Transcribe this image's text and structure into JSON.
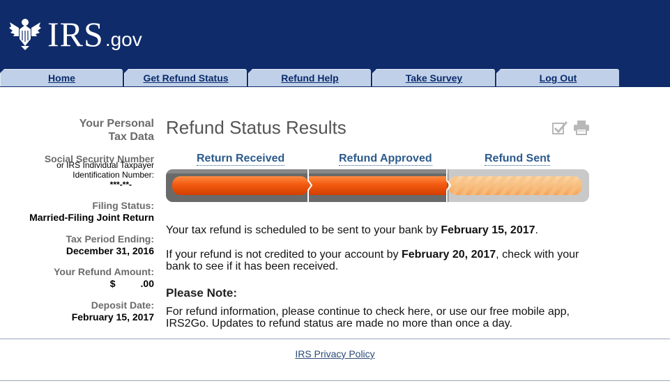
{
  "header": {
    "logo_text": "IRS",
    "logo_suffix": ".gov"
  },
  "nav": {
    "tabs": [
      {
        "label": "Home"
      },
      {
        "label": "Get Refund Status"
      },
      {
        "label": "Refund Help"
      },
      {
        "label": "Take Survey"
      },
      {
        "label": "Log Out"
      }
    ]
  },
  "sidebar": {
    "heading_line1": "Your Personal",
    "heading_line2": "Tax Data",
    "ssn_label": "Social Security Number",
    "ssn_sub1": "or IRS Individual Taxpayer",
    "ssn_sub2": "Identification Number:",
    "ssn_value": "***-**-",
    "filing_label": "Filing Status:",
    "filing_value": "Married-Filing Joint Return",
    "period_label": "Tax Period Ending:",
    "period_value": "December 31, 2016",
    "amount_label": "Your Refund Amount:",
    "amount_currency": "$",
    "amount_value": ".00",
    "deposit_label": "Deposit Date:",
    "deposit_value": "February 15, 2017"
  },
  "main": {
    "title": "Refund Status Results",
    "steps": [
      "Return Received",
      "Refund Approved",
      "Refund Sent"
    ],
    "progress": {
      "completed_steps": 2,
      "total_steps": 3
    },
    "msg1_pre": "Your tax refund is scheduled to be sent to your bank by ",
    "msg1_date": "February 15, 2017",
    "msg1_post": ".",
    "msg2_pre": "If your refund is not credited to your account by ",
    "msg2_date": "February 20, 2017",
    "msg2_post": ", check with your bank to see if it has been received.",
    "note_heading": "Please Note:",
    "note_text": "For refund information, please continue to check here, or use our free mobile app, IRS2Go. Updates to refund status are made no more than once a day."
  },
  "icons": {
    "check": "checkmark-icon",
    "print": "print-icon"
  },
  "footer": {
    "privacy_link": "IRS Privacy Policy"
  },
  "colors": {
    "header_bg": "#0f2b6a",
    "tab_bg": "#bfd0e8",
    "progress_fill": "#f25a10",
    "progress_pending": "#f8b46a"
  }
}
